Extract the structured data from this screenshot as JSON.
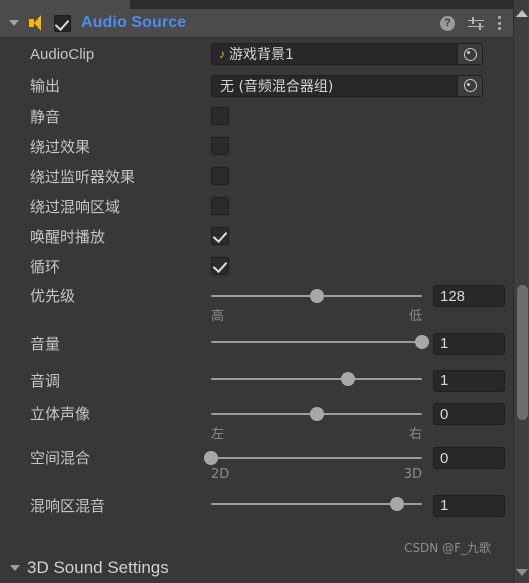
{
  "header": {
    "title": "Audio Source",
    "enabled": true,
    "foldout_open": true,
    "icon": "speaker-icon",
    "actions": [
      {
        "name": "help-icon",
        "glyph": "?"
      },
      {
        "name": "preset-icon",
        "glyph": ""
      },
      {
        "name": "more-menu-icon",
        "glyph": ""
      }
    ]
  },
  "fields": {
    "audio_clip": {
      "label": "AudioClip",
      "value": "游戏背景1",
      "icon": "music-note-icon"
    },
    "output": {
      "label": "输出",
      "value": "无 (音频混合器组)"
    },
    "mute": {
      "label": "静音",
      "checked": false
    },
    "bypass_effects": {
      "label": "绕过效果",
      "checked": false
    },
    "bypass_listener_effects": {
      "label": "绕过监听器效果",
      "checked": false
    },
    "bypass_reverb_zones": {
      "label": "绕过混响区域",
      "checked": false
    },
    "play_on_awake": {
      "label": "唤醒时播放",
      "checked": true
    },
    "loop": {
      "label": "循环",
      "checked": true
    }
  },
  "sliders": [
    {
      "name": "priority",
      "label": "优先级",
      "value": "128",
      "percent": 50,
      "left_label": "高",
      "right_label": "低"
    },
    {
      "name": "volume",
      "label": "音量",
      "value": "1",
      "percent": 100,
      "left_label": "",
      "right_label": ""
    },
    {
      "name": "pitch",
      "label": "音调",
      "value": "1",
      "percent": 65,
      "left_label": "",
      "right_label": ""
    },
    {
      "name": "stereo-pan",
      "label": "立体声像",
      "value": "0",
      "percent": 50,
      "left_label": "左",
      "right_label": "右"
    },
    {
      "name": "spatial-blend",
      "label": "空间混合",
      "value": "0",
      "percent": 0,
      "left_label": "2D",
      "right_label": "3D"
    },
    {
      "name": "reverb-zone-mix",
      "label": "混响区混音",
      "value": "1",
      "percent": 88,
      "left_label": "",
      "right_label": ""
    }
  ],
  "footer": {
    "section_title": "3D Sound Settings",
    "expanded": true
  },
  "watermark": "CSDN @F_九歌",
  "colors": {
    "accent_title": "#4f8bf0",
    "icon_orange": "#ffb400",
    "panel_bg": "#383838",
    "header_bg": "#4b4b4b",
    "field_bg": "#282828"
  }
}
